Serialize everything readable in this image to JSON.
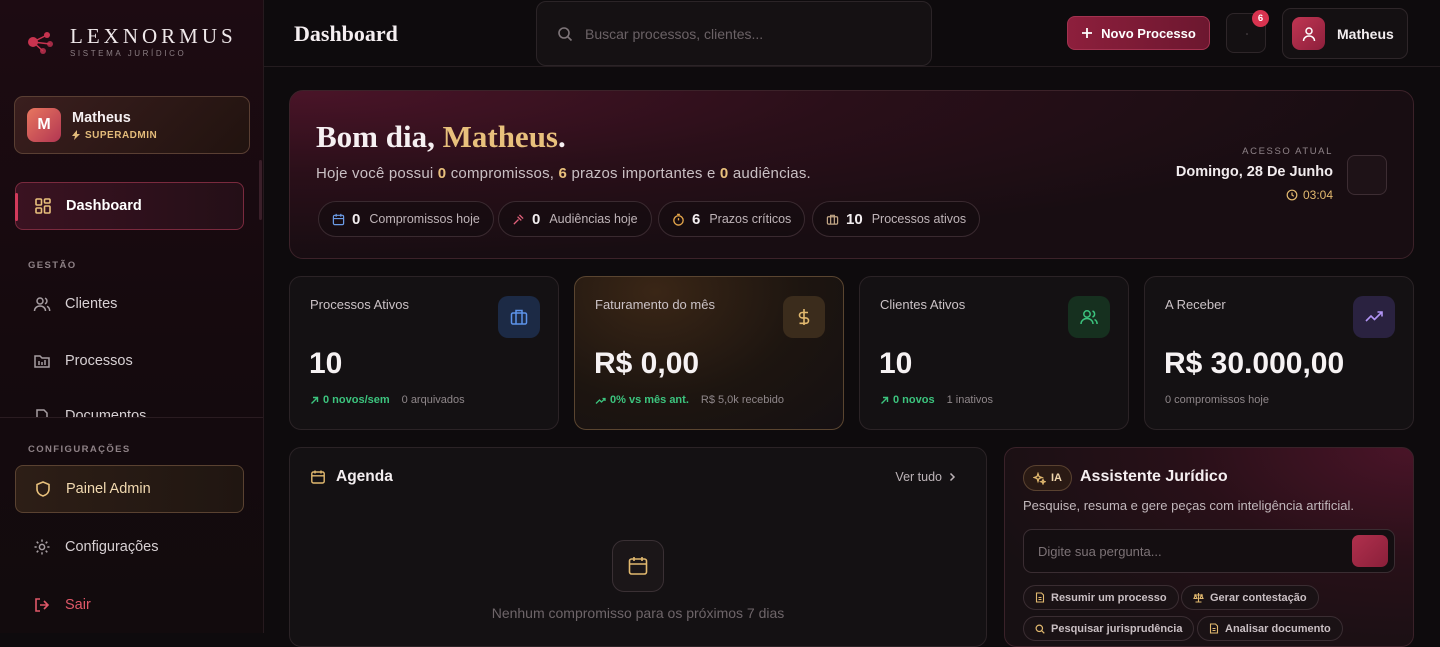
{
  "brand": {
    "name": "LEXNORMUS",
    "subtitle": "SISTEMA JURÍDICO"
  },
  "sidebar": {
    "user": {
      "initial": "M",
      "name": "Matheus",
      "role": "SUPERADMIN"
    },
    "items": [
      {
        "label": "Dashboard",
        "icon": "grid-icon",
        "active": true
      },
      {
        "label": "Clientes",
        "icon": "users-icon"
      },
      {
        "label": "Processos",
        "icon": "folder-icon"
      },
      {
        "label": "Documentos",
        "icon": "document-icon"
      }
    ],
    "section_gestao": "GESTÃO",
    "section_config": "CONFIGURAÇÕES",
    "admin": "Painel Admin",
    "settings": "Configurações",
    "logout": "Sair"
  },
  "header": {
    "title": "Dashboard",
    "search_placeholder": "Buscar processos, clientes...",
    "new_button": "Novo Processo",
    "notifications": "6",
    "user": "Matheus"
  },
  "hero": {
    "greeting": "Bom dia, ",
    "name": "Matheus",
    "dot": ".",
    "sub": {
      "p1": "Hoje você possui ",
      "n1": "0",
      "p2": " compromissos, ",
      "n2": "6",
      "p3": " prazos importantes e ",
      "n3": "0",
      "p4": " audiências."
    },
    "chips": [
      {
        "value": "0",
        "label": "Compromissos hoje",
        "icon": "calendar-icon"
      },
      {
        "value": "0",
        "label": "Audiências hoje",
        "icon": "gavel-icon"
      },
      {
        "value": "6",
        "label": "Prazos críticos",
        "icon": "timer-icon"
      },
      {
        "value": "10",
        "label": "Processos ativos",
        "icon": "briefcase-icon"
      }
    ],
    "access_label": "ACESSO ATUAL",
    "access_date": "Domingo, 28 De Junho",
    "access_time": "03:04"
  },
  "stats": [
    {
      "title": "Processos Ativos",
      "value": "10",
      "trend": "0 novos/sem",
      "note": "0 arquivados",
      "icon": "briefcase-icon",
      "color": "#4f86e0"
    },
    {
      "title": "Faturamento do mês",
      "value": "R$ 0,00",
      "trend": "0% vs mês ant.",
      "note": "R$ 5,0k recebido",
      "icon": "dollar-icon",
      "color": "#e2b96f"
    },
    {
      "title": "Clientes Ativos",
      "value": "10",
      "trend": "0 novos",
      "note": "1 inativos",
      "icon": "users-icon",
      "color": "#3cc47e"
    },
    {
      "title": "A Receber",
      "value": "R$ 30.000,00",
      "trend": "",
      "note": "0 compromissos hoje",
      "icon": "trending-up-icon",
      "color": "#a685f0"
    }
  ],
  "agenda": {
    "title": "Agenda",
    "see_all": "Ver tudo",
    "empty": "Nenhum compromisso para os próximos 7 dias"
  },
  "assistant": {
    "badge": "IA",
    "title": "Assistente Jurídico",
    "subtitle": "Pesquise, resuma e gere peças com inteligência artificial.",
    "placeholder": "Digite sua pergunta...",
    "chips": [
      "Resumir um processo",
      "Gerar contestação",
      "Pesquisar jurisprudência",
      "Analisar documento"
    ]
  }
}
